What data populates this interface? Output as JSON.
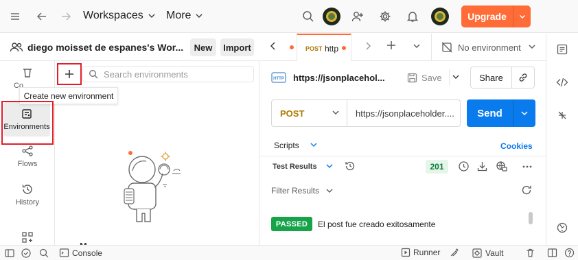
{
  "topbar": {
    "workspaces_label": "Workspaces",
    "more_label": "More",
    "upgrade_label": "Upgrade"
  },
  "workspace": {
    "name": "diego moisset de espanes's Wor...",
    "new_label": "New",
    "import_label": "Import"
  },
  "rail": {
    "collections_label": "Co",
    "environments_label": "Environments",
    "flows_label": "Flows",
    "history_label": "History"
  },
  "environments": {
    "search_placeholder": "Search environments",
    "tooltip": "Create new environment",
    "empty_text": "M  · · · · · · · · · ·"
  },
  "tabs": {
    "active_method": "POST",
    "active_title": "http",
    "env_selector": "No environment"
  },
  "request": {
    "name": "https://jsonplaceholder.typicode.com/posts",
    "name_display": "https://jsonplacehol...",
    "save_label": "Save",
    "share_label": "Share",
    "method": "POST",
    "url_display": "https://jsonplaceholder....",
    "send_label": "Send",
    "scripts_label": "Scripts",
    "cookies_label": "Cookies"
  },
  "response": {
    "test_results_label": "Test Results",
    "status_code": "201",
    "filter_label": "Filter Results",
    "tests": [
      {
        "status": "PASSED",
        "name": "El post fue creado exitosamente"
      }
    ]
  },
  "statusbar": {
    "console_label": "Console",
    "runner_label": "Runner",
    "vault_label": "Vault"
  },
  "colors": {
    "accent": "#ff6c37",
    "send": "#097bed",
    "passed": "#16a34a",
    "highlight": "#e11e2a"
  }
}
